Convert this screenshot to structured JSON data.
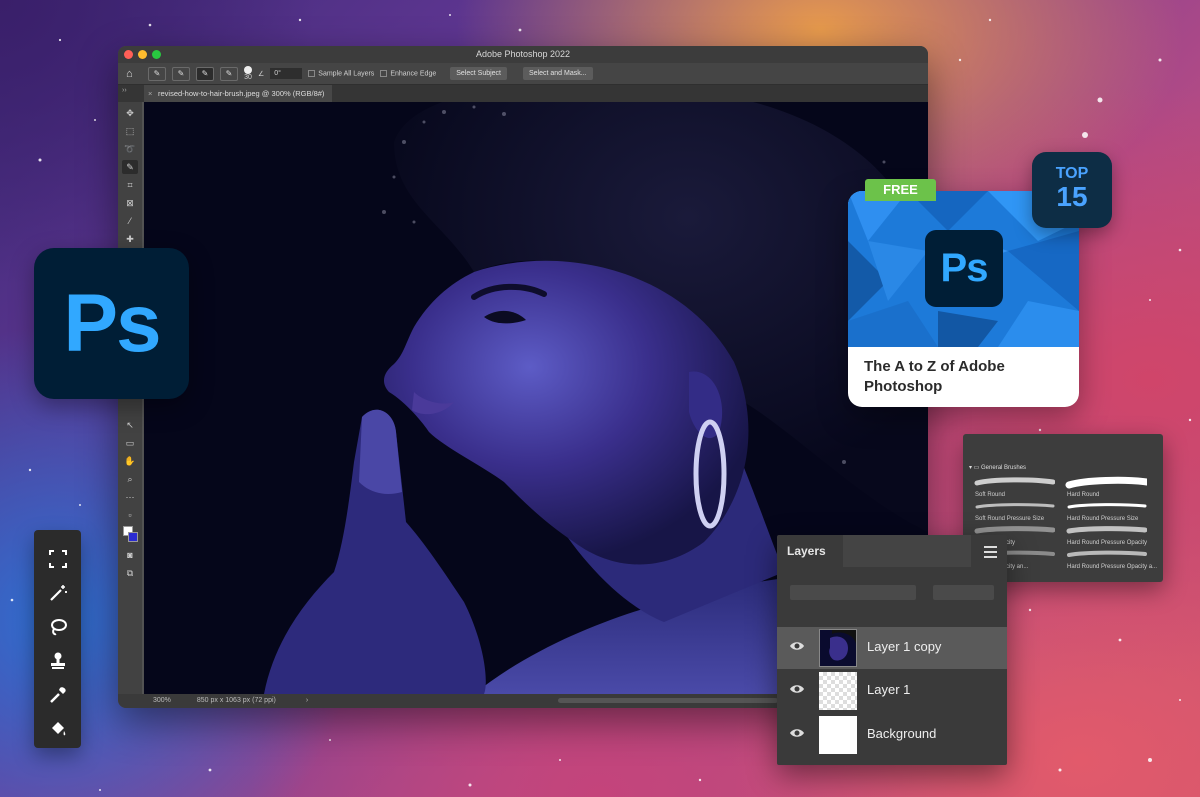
{
  "window": {
    "title": "Adobe Photoshop 2022",
    "traffic_lights": [
      "#ff5f57",
      "#febc2e",
      "#28c840"
    ]
  },
  "options_bar": {
    "brush_size": "30",
    "angle_value": "0°",
    "sample_all_layers": "Sample All Layers",
    "enhance_edge": "Enhance Edge",
    "select_subject": "Select Subject",
    "select_and_mask": "Select and Mask..."
  },
  "document": {
    "tab_title": "revised-how-to-hair-brush.jpeg @ 300% (RGB/8#)",
    "tab_close": "×"
  },
  "status_bar": {
    "zoom": "300%",
    "doc_info": "850 px x 1063 px (72 ppi)",
    "arrow": "›"
  },
  "left_badge": {
    "label": "Ps",
    "bg": "#001e36",
    "fg": "#31a8ff"
  },
  "course_card": {
    "tag": "FREE",
    "logo": "Ps",
    "title": "The A to Z of Adobe Photoshop",
    "accent": "#6cc24a"
  },
  "top_badge": {
    "line1": "TOP",
    "line2": "15"
  },
  "brushes_panel": {
    "group": "General Brushes",
    "items": [
      "Soft Round",
      "Hard Round",
      "Soft Round Pressure Size",
      "Hard Round Pressure Size",
      "essure Opacity",
      "Hard Round Pressure Opacity",
      "essure Opacity an...",
      "Hard Round Pressure Opacity a..."
    ]
  },
  "layers_panel": {
    "title": "Layers",
    "layers": [
      "Layer 1 copy",
      "Layer 1",
      "Background"
    ]
  },
  "floating_palette": {
    "tools": [
      "marquee-icon",
      "magic-wand-icon",
      "lasso-icon",
      "stamp-icon",
      "eyedropper-icon",
      "paint-bucket-icon"
    ]
  }
}
